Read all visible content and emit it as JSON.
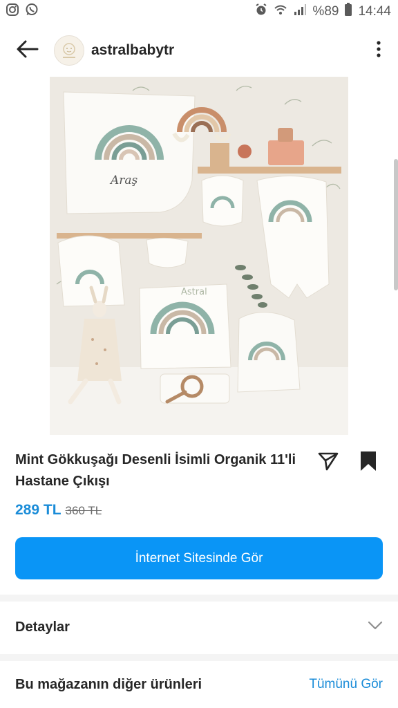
{
  "status_bar": {
    "left_icons": [
      "instagram-icon",
      "whatsapp-icon"
    ],
    "battery_text": "%89",
    "time": "14:44"
  },
  "header": {
    "username": "astralbabytr"
  },
  "product": {
    "image_watermark": "Astral",
    "name_on_items": "Araş",
    "title": "Mint Gökkuşağı Desenli İsimli Organik 11'li Hastane Çıkışı",
    "price": "289 TL",
    "old_price": "360 TL",
    "cta_label": "İnternet Sitesinde Gör"
  },
  "sections": {
    "details_label": "Detaylar",
    "more_products_label": "Bu mağazanın diğer ürünleri",
    "see_all_label": "Tümünü Gör"
  },
  "colors": {
    "accent": "#0a95f6",
    "price": "#1a8cd8",
    "text": "#262626"
  }
}
